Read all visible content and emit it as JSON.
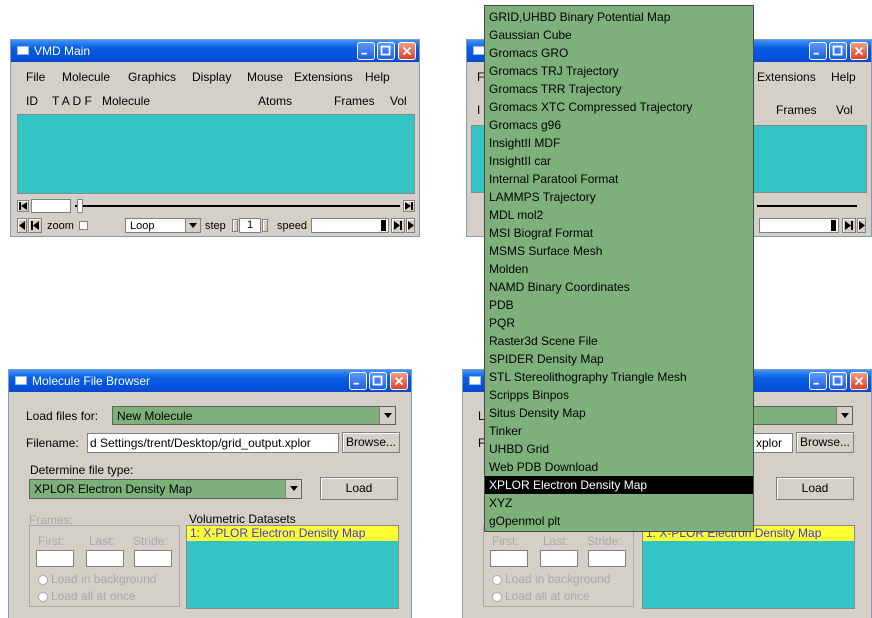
{
  "vmd_main_left": {
    "title": "VMD Main",
    "menu": [
      "File",
      "Molecule",
      "Graphics",
      "Display",
      "Mouse",
      "Extensions",
      "Help"
    ],
    "columns": {
      "id": "ID",
      "flags": "T A D F",
      "molecule": "Molecule",
      "atoms": "Atoms",
      "frames": "Frames",
      "vol": "Vol"
    },
    "anim": {
      "zoom_label": "zoom",
      "loop_label": "Loop",
      "step_label": "step",
      "step_value": "1",
      "speed_label": "speed"
    }
  },
  "vmd_main_right": {
    "menu_visible": [
      "F",
      "Extensions",
      "Help"
    ],
    "columns_visible": {
      "id": "I",
      "frames": "Frames",
      "vol": "Vol"
    }
  },
  "browser_left": {
    "title": "Molecule File Browser",
    "load_for_label": "Load files for:",
    "load_for_value": "New Molecule",
    "filename_label": "Filename:",
    "filename_value": "d Settings/trent/Desktop/grid_output.xplor",
    "browse_label": "Browse...",
    "file_type_label": "Determine file type:",
    "file_type_value": "XPLOR Electron Density Map",
    "load_label": "Load",
    "frames_label": "Frames:",
    "first_label": "First:",
    "last_label": "Last:",
    "stride_label": "Stride:",
    "bg_label": "Load in background",
    "once_label": "Load all at once",
    "volumetric_label": "Volumetric Datasets",
    "dataset": "1: X-PLOR Electron Density Map"
  },
  "browser_right": {
    "load_for_letter": "L",
    "filename_letter": "F",
    "filename_value_tail": "xplor",
    "browse_label": "Browse...",
    "load_label": "Load",
    "first_label": "First:",
    "last_label": "Last:",
    "stride_label": "Stride:",
    "bg_label": "Load in background",
    "once_label": "Load all at once",
    "dataset_tail": "1: X-PLOR Electron Density Map"
  },
  "file_type_dropdown": {
    "items": [
      "GRID,UHBD Binary Potential Map",
      "Gaussian Cube",
      "Gromacs GRO",
      "Gromacs TRJ Trajectory",
      "Gromacs TRR Trajectory",
      "Gromacs XTC Compressed Trajectory",
      "Gromacs g96",
      "InsightII MDF",
      "InsightII car",
      "Internal Paratool Format",
      "LAMMPS Trajectory",
      "MDL mol2",
      "MSI Biograf Format",
      "MSMS Surface Mesh",
      "Molden",
      "NAMD Binary Coordinates",
      "PDB",
      "PQR",
      "Raster3d Scene File",
      "SPIDER Density Map",
      "STL Stereolithography Triangle Mesh",
      "Scripps Binpos",
      "Situs Density Map",
      "Tinker",
      "UHBD Grid",
      "Web PDB Download",
      "XPLOR Electron Density Map",
      "XYZ",
      "gOpenmol plt"
    ],
    "selected_index": 26
  },
  "colors": {
    "titlebar_blue": "#0054e3",
    "panel_gray": "#d4d0c8",
    "cyan": "#33c4c4",
    "menu_green": "#7db07a",
    "selection_yellow": "#ffff33"
  }
}
